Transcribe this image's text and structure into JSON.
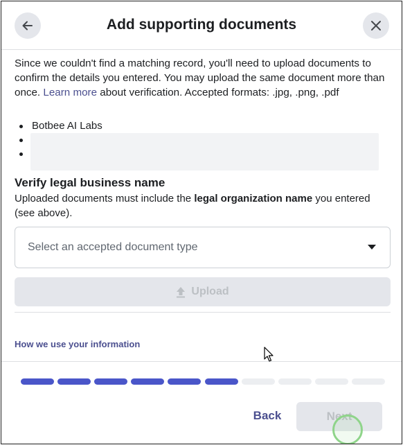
{
  "dialog": {
    "title": "Add supporting documents",
    "back_icon": "arrow-left-icon",
    "close_icon": "close-icon"
  },
  "intro": {
    "text_before_link": "Since we couldn't find a matching record, you'll need to upload documents to confirm the details you entered. You may upload the same document more than once. ",
    "link_text": "Learn more",
    "text_after_link": " about verification. Accepted formats: .jpg, .png, .pdf"
  },
  "details": {
    "items": [
      "Botbee AI Labs",
      "",
      ""
    ]
  },
  "verify_section": {
    "title": "Verify legal business name",
    "desc_before": "Uploaded documents must include the ",
    "desc_bold": "legal organization name",
    "desc_after": " you entered (see above)."
  },
  "document_type_select": {
    "placeholder": "Select an accepted document type",
    "caret_icon": "caret-down-icon"
  },
  "upload_button": {
    "label": "Upload",
    "icon": "upload-arrow-icon",
    "enabled": false
  },
  "info_link": "How we use your information",
  "progress": {
    "total_steps": 10,
    "completed_steps": 6,
    "active_color": "#4a56c9",
    "inactive_color": "#eceef1"
  },
  "footer": {
    "back_label": "Back",
    "next_label": "Next",
    "next_enabled": false
  },
  "colors": {
    "link": "#4b4f8f",
    "disabled_bg": "#e4e6eb",
    "disabled_text": "#bcc0c4"
  }
}
